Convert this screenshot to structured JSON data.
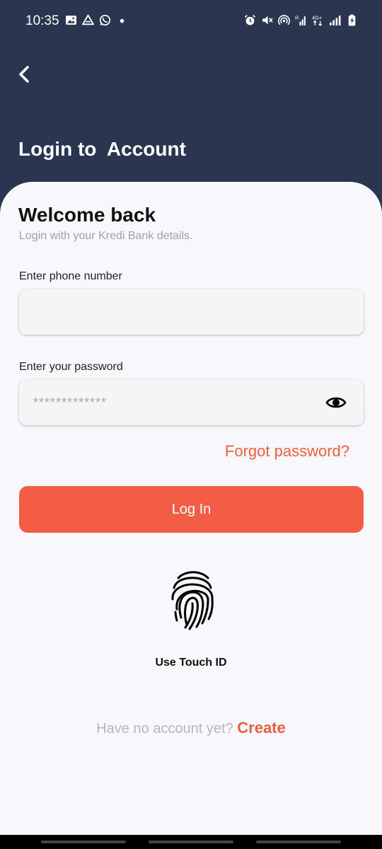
{
  "status_bar": {
    "time": "10:35",
    "left_icons": [
      "image-icon",
      "drive-icon",
      "whatsapp-icon",
      "dot-icon"
    ],
    "right_icons": [
      "alarm-icon",
      "mute-icon",
      "hotspot-icon",
      "signal-r-icon",
      "network-4g-icon",
      "signal-icon",
      "battery-charging-icon"
    ]
  },
  "header": {
    "title": "Login to  Account",
    "back_icon": "chevron-left-icon"
  },
  "card": {
    "title": "Welcome back",
    "subtitle": "Login with your Kredi Bank details."
  },
  "form": {
    "phone_label": "Enter phone number",
    "phone_value": "",
    "password_label": "Enter your password",
    "password_placeholder": "*************",
    "forgot_label": "Forgot password?",
    "login_label": "Log In"
  },
  "touch_id": {
    "icon": "fingerprint-icon",
    "label": "Use Touch ID"
  },
  "signup": {
    "prompt": "Have no account yet?",
    "link": "Create"
  },
  "colors": {
    "header_bg": "#2a3650",
    "card_bg": "#f7f7fc",
    "accent": "#f25d45",
    "link": "#e8603f"
  }
}
